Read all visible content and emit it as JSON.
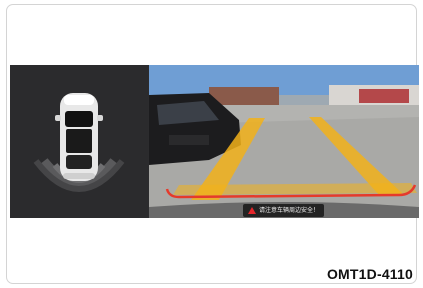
{
  "display": {
    "warning_text": "请注意车辆周边安全！",
    "guide_line_color": "#f2b21a",
    "distance_line_color": "#e53a2b",
    "warning_icon": "warning-triangle-icon"
  },
  "figure": {
    "code": "OMT1D-4110"
  }
}
